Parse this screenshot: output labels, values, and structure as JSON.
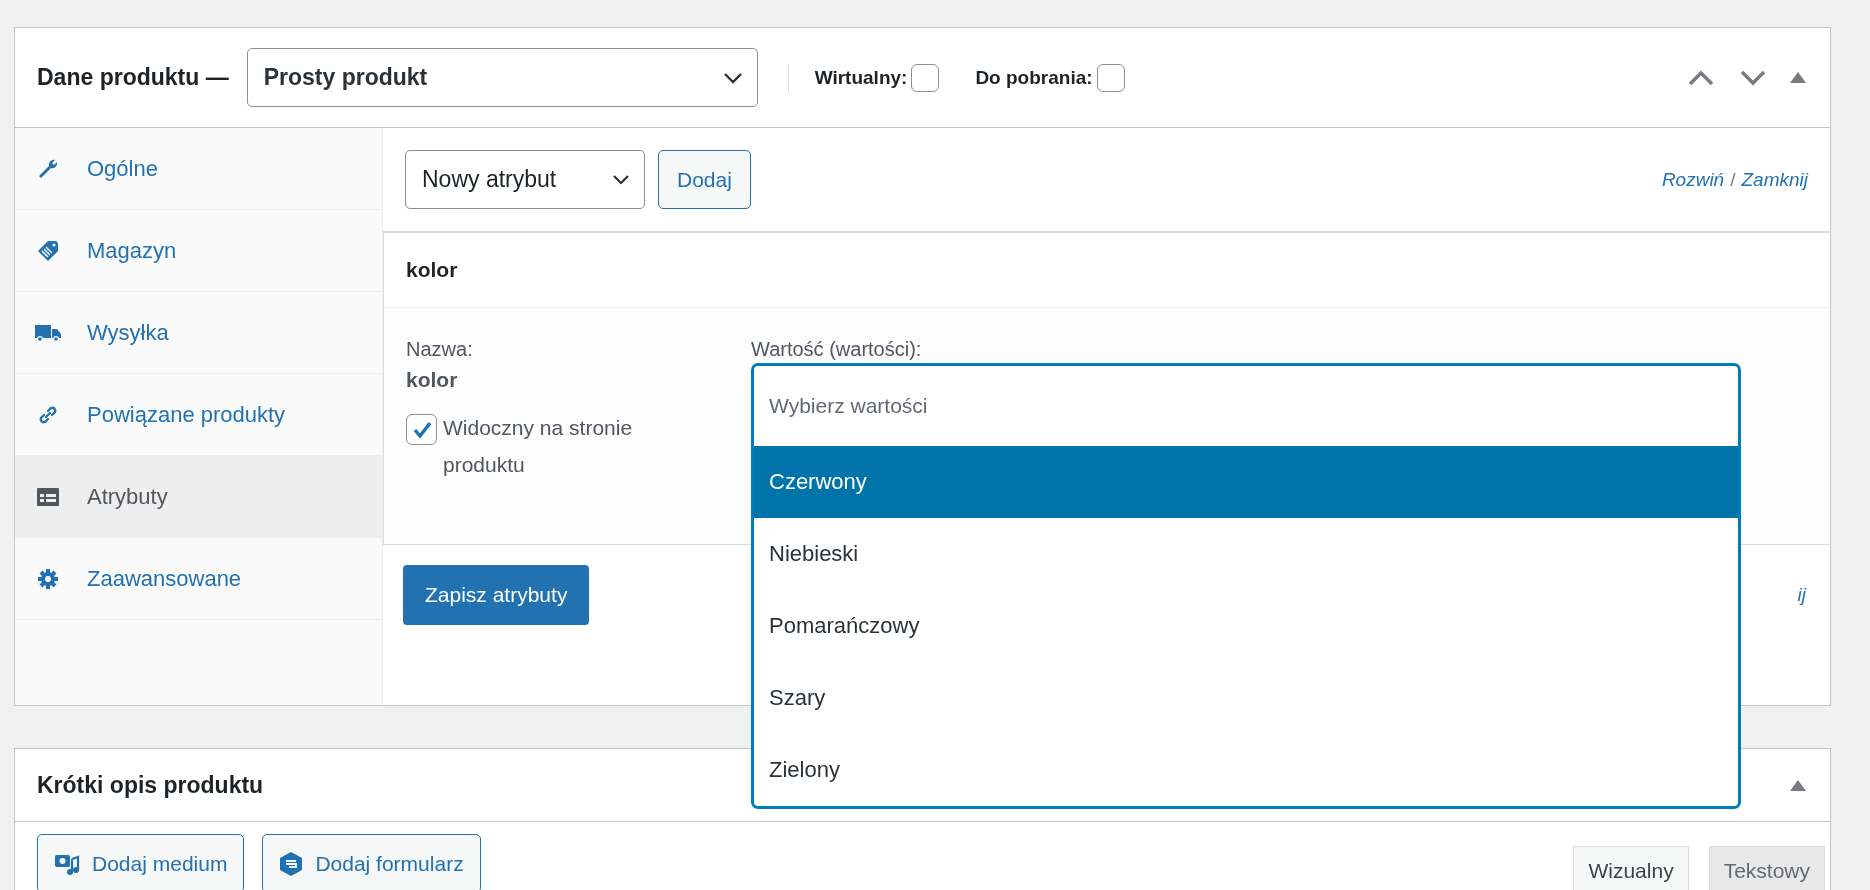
{
  "product_data": {
    "title": "Dane produktu —",
    "product_type": "Prosty produkt",
    "options": [
      {
        "label": "Wirtualny:",
        "checked": false
      },
      {
        "label": "Do pobrania:",
        "checked": false
      }
    ]
  },
  "tabs": [
    {
      "label": "Ogólne",
      "selected": false
    },
    {
      "label": "Magazyn",
      "selected": false
    },
    {
      "label": "Wysyłka",
      "selected": false
    },
    {
      "label": "Powiązane produkty",
      "selected": false
    },
    {
      "label": "Atrybuty",
      "selected": true
    },
    {
      "label": "Zaawansowane",
      "selected": false
    }
  ],
  "attributes_toolbar": {
    "new_attribute": "Nowy atrybut",
    "add_button": "Dodaj",
    "expand": "Rozwiń",
    "separator": "/",
    "collapse": "Zamknij"
  },
  "attribute": {
    "header": "kolor",
    "name_label": "Nazwa:",
    "name_value": "kolor",
    "visible": {
      "label": "Widoczny na stronie produktu",
      "checked": true
    },
    "values_label": "Wartość (wartości):",
    "values_placeholder": "Wybierz wartości",
    "options": [
      {
        "label": "Czerwony",
        "selected": true
      },
      {
        "label": "Niebieski",
        "selected": false
      },
      {
        "label": "Pomarańczowy",
        "selected": false
      },
      {
        "label": "Szary",
        "selected": false
      },
      {
        "label": "Zielony",
        "selected": false
      }
    ]
  },
  "save_button": "Zapisz atrybuty",
  "footer_link_fragment": "ij",
  "short_description": {
    "title": "Krótki opis produktu",
    "buttons": [
      "Dodaj medium",
      "Dodaj formularz"
    ],
    "modes": [
      {
        "label": "Wizualny",
        "selected": true
      },
      {
        "label": "Tekstowy",
        "selected": false
      }
    ]
  }
}
